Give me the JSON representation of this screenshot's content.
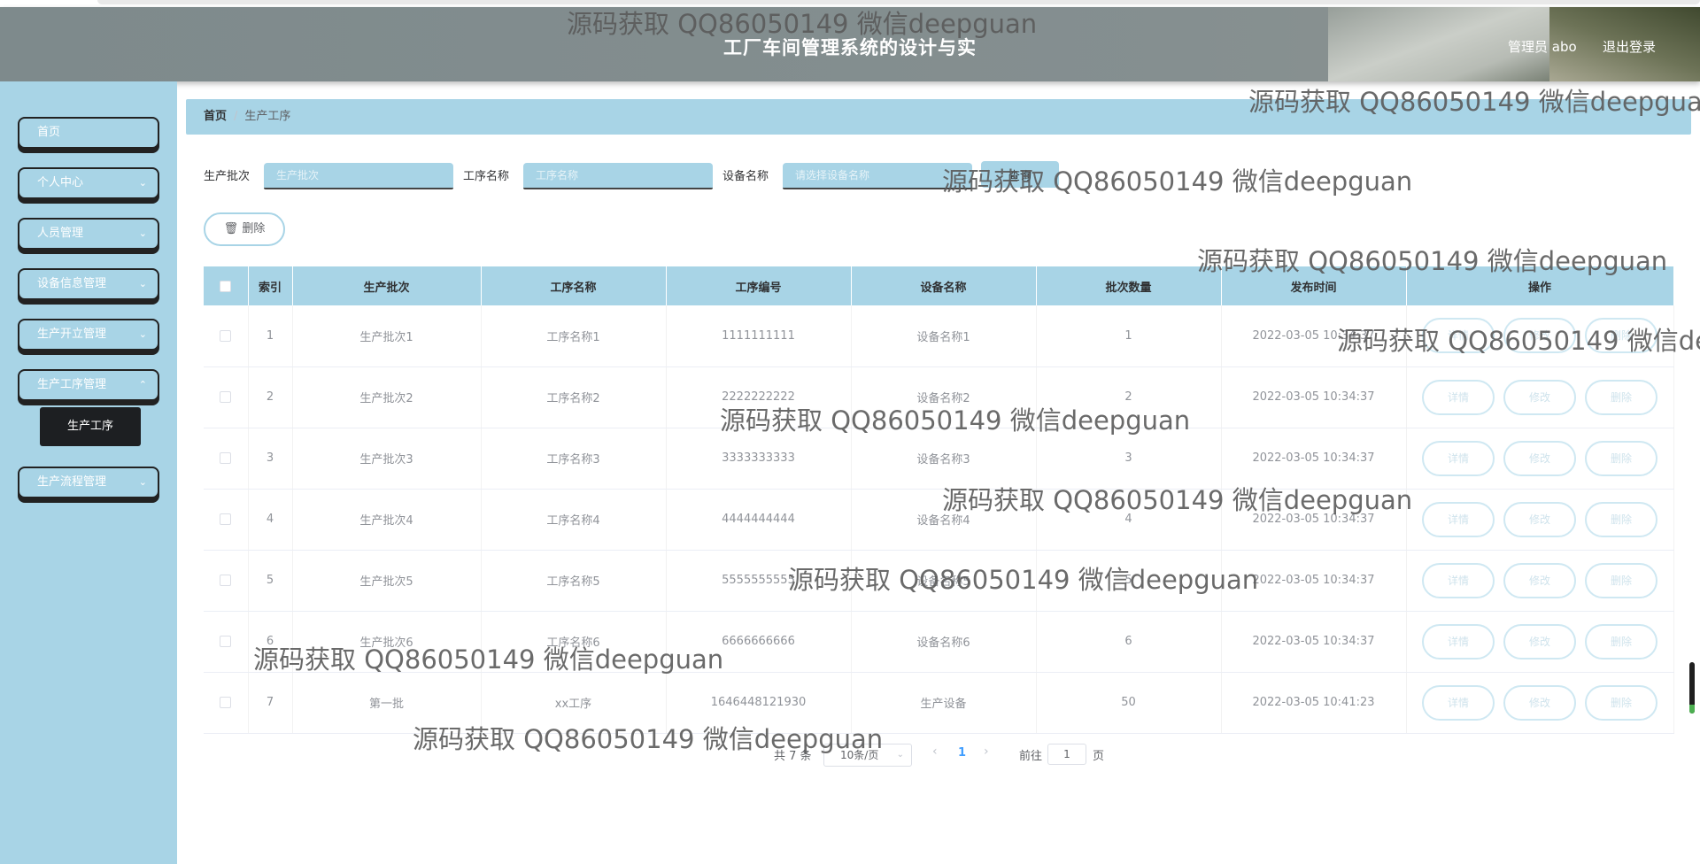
{
  "header": {
    "title": "工厂车间管理系统的设计与实",
    "user_label": "管理员 abo",
    "logout_label": "退出登录"
  },
  "sidebar": {
    "items": [
      {
        "label": "首页"
      },
      {
        "label": "个人中心"
      },
      {
        "label": "人员管理"
      },
      {
        "label": "设备信息管理"
      },
      {
        "label": "生产开立管理"
      },
      {
        "label": "生产工序管理"
      },
      {
        "label": "生产流程管理"
      }
    ],
    "submenu_label": "生产工序"
  },
  "breadcrumb": {
    "home": "首页",
    "current": "生产工序"
  },
  "search": {
    "batch_label": "生产批次",
    "batch_placeholder": "生产批次",
    "process_label": "工序名称",
    "process_placeholder": "工序名称",
    "device_label": "设备名称",
    "device_placeholder": "请选择设备名称",
    "search_button": "查询"
  },
  "toolbar": {
    "delete_label": "删除"
  },
  "table": {
    "headers": [
      "索引",
      "生产批次",
      "工序名称",
      "工序编号",
      "设备名称",
      "批次数量",
      "发布时间",
      "操作"
    ],
    "rows": [
      {
        "index": "1",
        "batch": "生产批次1",
        "process": "工序名称1",
        "code": "1111111111",
        "device": "设备名称1",
        "qty": "1",
        "time": "2022-03-05 10:34:37"
      },
      {
        "index": "2",
        "batch": "生产批次2",
        "process": "工序名称2",
        "code": "2222222222",
        "device": "设备名称2",
        "qty": "2",
        "time": "2022-03-05 10:34:37"
      },
      {
        "index": "3",
        "batch": "生产批次3",
        "process": "工序名称3",
        "code": "3333333333",
        "device": "设备名称3",
        "qty": "3",
        "time": "2022-03-05 10:34:37"
      },
      {
        "index": "4",
        "batch": "生产批次4",
        "process": "工序名称4",
        "code": "4444444444",
        "device": "设备名称4",
        "qty": "4",
        "time": "2022-03-05 10:34:37"
      },
      {
        "index": "5",
        "batch": "生产批次5",
        "process": "工序名称5",
        "code": "5555555555",
        "device": "设备名称5",
        "qty": "5",
        "time": "2022-03-05 10:34:37"
      },
      {
        "index": "6",
        "batch": "生产批次6",
        "process": "工序名称6",
        "code": "6666666666",
        "device": "设备名称6",
        "qty": "6",
        "time": "2022-03-05 10:34:37"
      },
      {
        "index": "7",
        "batch": "第一批",
        "process": "xx工序",
        "code": "1646448121930",
        "device": "生产设备",
        "qty": "50",
        "time": "2022-03-05 10:41:23"
      }
    ],
    "op_detail": "详情",
    "op_edit": "修改",
    "op_delete": "删除"
  },
  "pagination": {
    "total": "共 7 条",
    "page_size": "10条/页",
    "current_page": "1",
    "goto_label": "前往",
    "goto_value": "1",
    "page_suffix": "页"
  },
  "watermark": "源码获取 QQ86050149 微信deepguan",
  "colors": {
    "primary": "#a8d4e6",
    "header": "#858f90",
    "active_menu": "#1d1f22"
  }
}
